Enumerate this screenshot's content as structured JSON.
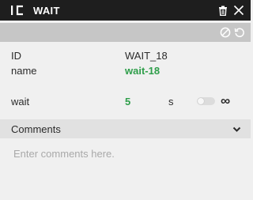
{
  "header": {
    "title": "WAIT"
  },
  "properties": {
    "id": {
      "label": "ID",
      "value": "WAIT_18"
    },
    "name": {
      "label": "name",
      "value": "wait-18"
    },
    "wait": {
      "label": "wait",
      "value": "5",
      "unit": "s",
      "infinite_label": "∞",
      "infinite_enabled": false
    }
  },
  "comments": {
    "title": "Comments",
    "placeholder": "Enter comments here."
  },
  "icons": {
    "logo": "logo-icon",
    "trash": "trash-icon",
    "close": "close-icon",
    "disable": "disable-icon",
    "reset": "reset-icon",
    "chevron": "chevron-down-icon"
  },
  "colors": {
    "titlebar": "#1e1e1e",
    "toolbar": "#c6c6c6",
    "accent": "#2e9e4a",
    "background": "#f0f0f0"
  }
}
